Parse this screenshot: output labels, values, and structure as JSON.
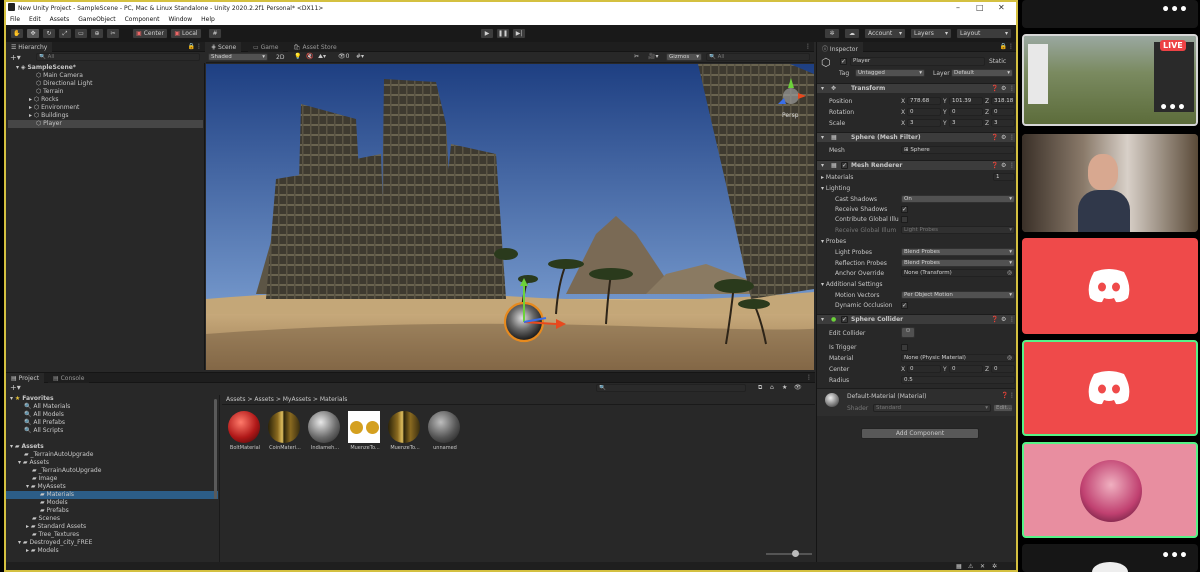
{
  "window": {
    "title": "New Unity Project - SampleScene - PC, Mac & Linux Standalone - Unity 2020.2.2f1 Personal* <DX11>",
    "menu": [
      "File",
      "Edit",
      "Assets",
      "GameObject",
      "Component",
      "Window",
      "Help"
    ]
  },
  "toolbar": {
    "pivot": "Center",
    "space": "Local",
    "account": "Account",
    "layers": "Layers",
    "layout": "Layout"
  },
  "hierarchy": {
    "tab": "Hierarchy",
    "search_placeholder": "All",
    "scene": "SampleScene*",
    "items": [
      "Main Camera",
      "Directional Light",
      "Terrain",
      "Rocks",
      "Environment",
      "Buildings",
      "Player"
    ]
  },
  "scene": {
    "tabs": [
      "Scene",
      "Game",
      "Asset Store"
    ],
    "shading": "Shaded",
    "mode_2d": "2D",
    "gizmos": "Gizmos",
    "search_placeholder": "All",
    "persp": "Persp",
    "colors": {
      "sky_top": "#1e3f82",
      "sky_bottom": "#8aaede",
      "sand": "#c8a676"
    }
  },
  "project": {
    "tabs": [
      "Project",
      "Console"
    ],
    "favorites_label": "Favorites",
    "favorites": [
      "All Materials",
      "All Models",
      "All Prefabs",
      "All Scripts"
    ],
    "assets_label": "Assets",
    "tree": [
      "_TerrainAutoUpgrade",
      "Assets",
      "_TerrainAutoUpgrade",
      "Image",
      "MyAssets",
      "Materials",
      "Models",
      "Prefabs",
      "Scenes",
      "Standard Assets",
      "Tree_Textures",
      "Destroyed_city_FREE",
      "Models"
    ],
    "breadcrumb": [
      "Assets",
      "Assets",
      "MyAssets",
      "Materials"
    ],
    "assets": [
      "BoltMaterial",
      "CoinMateri...",
      "Indiameh...",
      "MuenzeTo...",
      "MuenzeTo...",
      "unnamed"
    ]
  },
  "inspector": {
    "tab": "Inspector",
    "name": "Player",
    "static": "Static",
    "tag_label": "Tag",
    "tag": "Untagged",
    "layer_label": "Layer",
    "layer": "Default",
    "transform": {
      "title": "Transform",
      "position_label": "Position",
      "position": [
        "778.68",
        "101.39",
        "318.18"
      ],
      "rotation_label": "Rotation",
      "rotation": [
        "0",
        "0",
        "0"
      ],
      "scale_label": "Scale",
      "scale": [
        "3",
        "3",
        "3"
      ]
    },
    "mesh_filter": {
      "title": "Sphere (Mesh Filter)",
      "mesh_label": "Mesh",
      "mesh": "Sphere"
    },
    "mesh_renderer": {
      "title": "Mesh Renderer",
      "materials_label": "Materials",
      "materials_count": "1",
      "lighting_label": "Lighting",
      "cast_shadows_label": "Cast Shadows",
      "cast_shadows": "On",
      "receive_shadows_label": "Receive Shadows",
      "contribute_gi_label": "Contribute Global Illu",
      "receive_gi_label": "Receive Global Illum",
      "receive_gi": "Light Probes",
      "probes_label": "Probes",
      "light_probes_label": "Light Probes",
      "light_probes": "Blend Probes",
      "reflection_probes_label": "Reflection Probes",
      "reflection_probes": "Blend Probes",
      "anchor_override_label": "Anchor Override",
      "anchor_override": "None (Transform)",
      "additional_label": "Additional Settings",
      "motion_vectors_label": "Motion Vectors",
      "motion_vectors": "Per Object Motion",
      "dynamic_occlusion_label": "Dynamic Occlusion"
    },
    "collider": {
      "title": "Sphere Collider",
      "edit_label": "Edit Collider",
      "trigger_label": "Is Trigger",
      "material_label": "Material",
      "material": "None (Physic Material)",
      "center_label": "Center",
      "center": [
        "0",
        "0",
        "0"
      ],
      "radius_label": "Radius",
      "radius": "0.5"
    },
    "default_material": {
      "title": "Default-Material (Material)",
      "shader_label": "Shader",
      "shader": "Standard",
      "edit": "Edit..."
    },
    "add_component": "Add Component"
  },
  "sidebar": {
    "live_badge": "LIVE",
    "discord_tile_color": "#ef4a4a",
    "avatar_tile_color": "#e88ea0"
  }
}
